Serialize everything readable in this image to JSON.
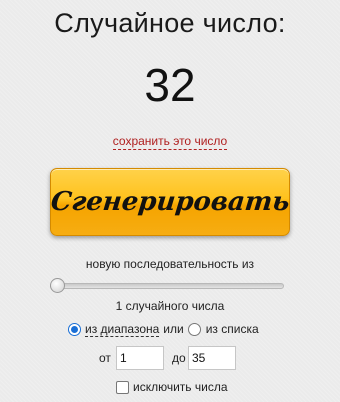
{
  "header": {
    "title": "Случайное число:"
  },
  "result": {
    "value": "32",
    "save_link": "сохранить это число"
  },
  "generate_button": {
    "label": "Сгенерировать"
  },
  "sequence": {
    "label": "новую последовательность из",
    "slider_value": 1,
    "count_label": "1 случайного числа"
  },
  "mode": {
    "selected": "range",
    "range_label": "из диапазона",
    "or_text": "или",
    "list_label": "из списка"
  },
  "range": {
    "from_label": "от",
    "from_value": "1",
    "to_label": "до",
    "to_value": "35"
  },
  "exclude": {
    "label": "исключить числа",
    "checked": false
  },
  "colors": {
    "accent": "#ffc21d",
    "link": "#b02020",
    "radio": "#1a6fd6"
  }
}
